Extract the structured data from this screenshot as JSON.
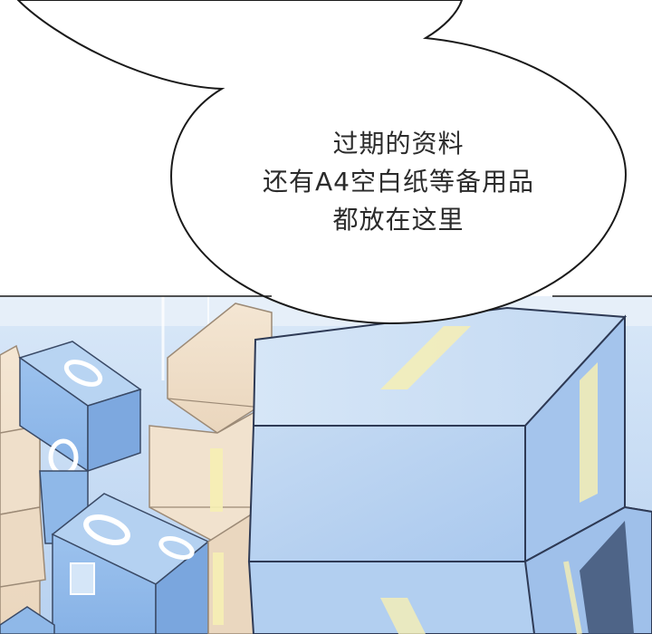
{
  "speech_bubble": {
    "lines": [
      "过期的资料",
      "还有A4空白纸等备用品",
      "都放在这里"
    ]
  },
  "colors": {
    "background": "#ffffff",
    "outline": "#1a1a1a",
    "box_blue": "#9fc4ee",
    "box_beige": "#f2e3cf",
    "tape_yellow": "#f6efb4"
  }
}
